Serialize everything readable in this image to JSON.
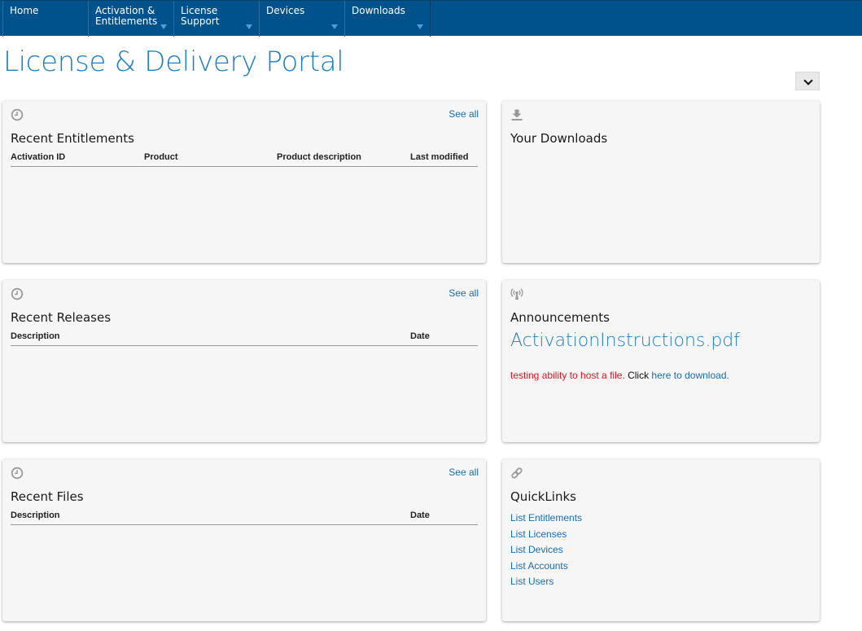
{
  "nav": {
    "items": [
      {
        "label": "Home",
        "has_dropdown": false
      },
      {
        "label": "Activation &\nEntitlements",
        "has_dropdown": true
      },
      {
        "label": "License Support",
        "has_dropdown": true
      },
      {
        "label": "Devices",
        "has_dropdown": true
      },
      {
        "label": "Downloads",
        "has_dropdown": true
      }
    ]
  },
  "page": {
    "title": "License & Delivery Portal"
  },
  "panels": {
    "recent_entitlements": {
      "icon": "clock-icon",
      "see_all": "See all",
      "title": "Recent Entitlements",
      "columns": [
        "Activation ID",
        "Product",
        "Product description",
        "Last modified"
      ],
      "rows": []
    },
    "your_downloads": {
      "icon": "download-icon",
      "title": "Your Downloads"
    },
    "recent_releases": {
      "icon": "clock-icon",
      "see_all": "See all",
      "title": "Recent Releases",
      "columns": [
        "Description",
        "Date"
      ],
      "rows": []
    },
    "announcements": {
      "icon": "broadcast-icon",
      "title": "Announcements",
      "file_link": "ActivationInstructions.pdf",
      "message_red": "testing ability to host a file.",
      "message_black": " Click ",
      "message_link": "here to download."
    },
    "recent_files": {
      "icon": "clock-icon",
      "see_all": "See all",
      "title": "Recent Files",
      "columns": [
        "Description",
        "Date"
      ],
      "rows": []
    },
    "quicklinks": {
      "icon": "link-icon",
      "title": "QuickLinks",
      "links": [
        "List Entitlements",
        "List Licenses",
        "List Devices",
        "List Accounts",
        "List Users"
      ]
    }
  },
  "colors": {
    "nav_bg": "#00528c",
    "title_blue": "#1e7fc2",
    "link_blue": "#1c6cae",
    "alert_red": "#e0141e",
    "panel_bg": "#f6f6f6"
  }
}
